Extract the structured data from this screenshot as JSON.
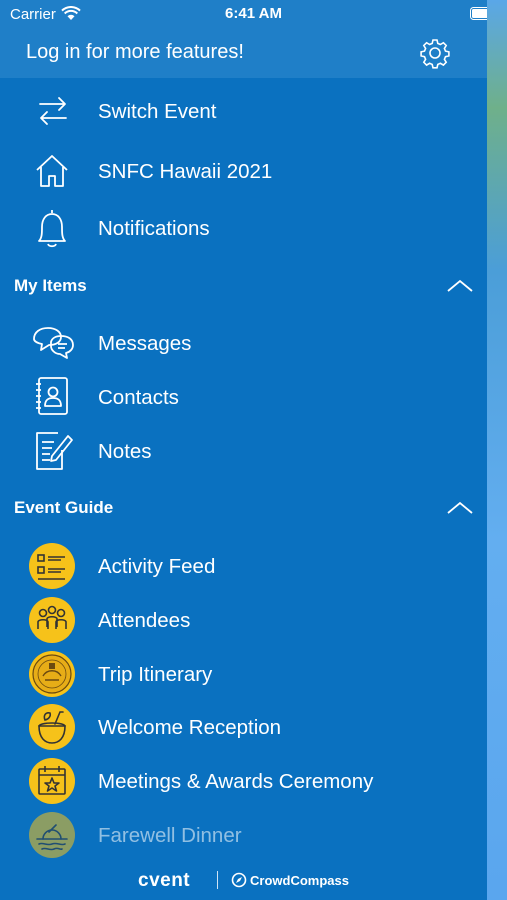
{
  "status_bar": {
    "carrier": "Carrier",
    "time": "6:41 AM"
  },
  "header": {
    "login_prompt": "Log in for more features!"
  },
  "top_items": [
    {
      "label": "Switch Event",
      "icon": "switch-arrows-icon"
    },
    {
      "label": "SNFC Hawaii 2021",
      "icon": "home-icon"
    },
    {
      "label": "Notifications",
      "icon": "bell-icon"
    }
  ],
  "my_items": {
    "title": "My Items",
    "items": [
      {
        "label": "Messages",
        "icon": "chat-bubbles-icon"
      },
      {
        "label": "Contacts",
        "icon": "contact-book-icon"
      },
      {
        "label": "Notes",
        "icon": "note-pencil-icon"
      }
    ]
  },
  "event_guide": {
    "title": "Event Guide",
    "items": [
      {
        "label": "Activity Feed",
        "icon": "activity-list-icon"
      },
      {
        "label": "Attendees",
        "icon": "people-icon"
      },
      {
        "label": "Trip Itinerary",
        "icon": "hawaii-seal-icon"
      },
      {
        "label": "Welcome Reception",
        "icon": "coconut-drink-icon"
      },
      {
        "label": "Meetings & Awards Ceremony",
        "icon": "calendar-star-icon"
      },
      {
        "label": "Farewell Dinner",
        "icon": "sunset-boat-icon"
      }
    ]
  },
  "footer": {
    "brand": "cvent",
    "partner": "CrowdCompass"
  },
  "colors": {
    "menu_bg": "#0a71c0",
    "header_bg": "#1f7fc8",
    "icon_circle": "#f6c21a"
  }
}
